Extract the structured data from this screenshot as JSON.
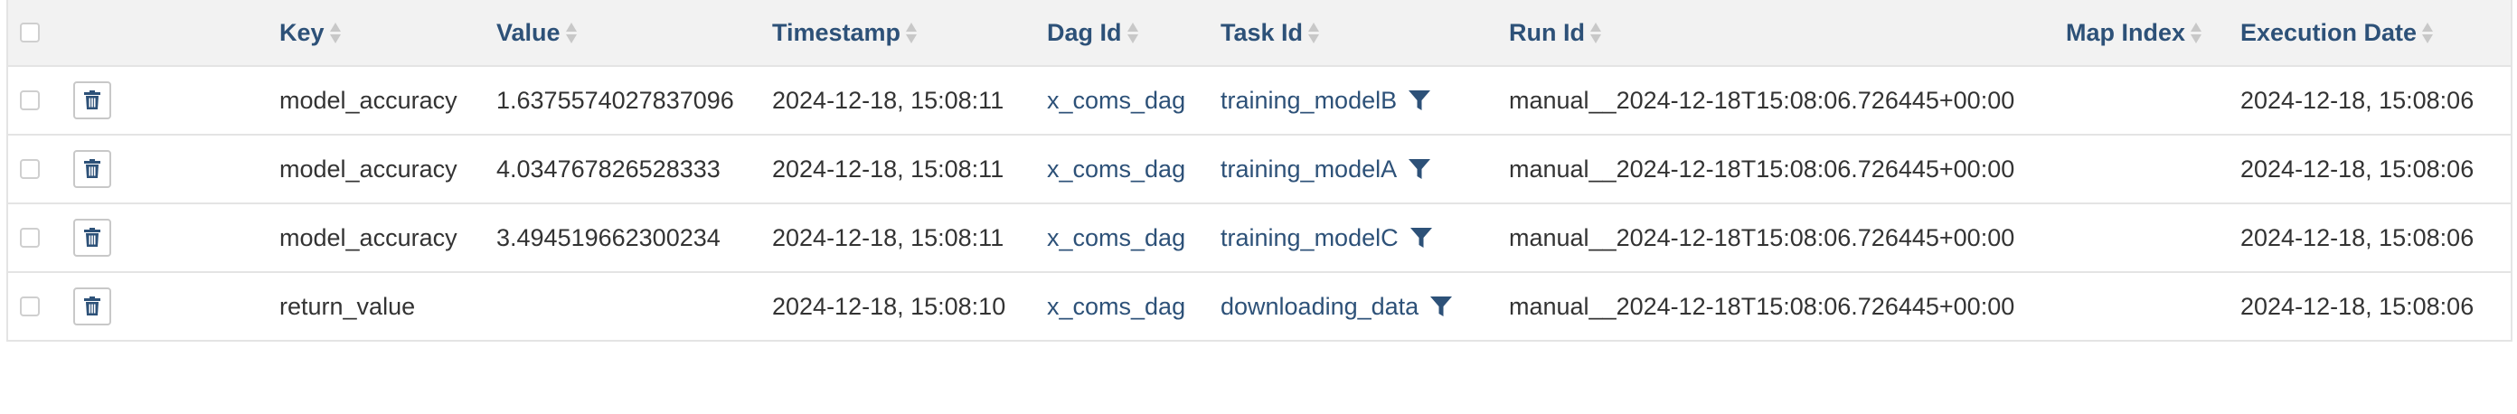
{
  "columns": {
    "key": "Key",
    "value": "Value",
    "timestamp": "Timestamp",
    "dag_id": "Dag Id",
    "task_id": "Task Id",
    "run_id": "Run Id",
    "map_index": "Map Index",
    "execution_date": "Execution Date"
  },
  "rows": [
    {
      "key": "model_accuracy",
      "value": "1.6375574027837096",
      "timestamp": "2024-12-18, 15:08:11",
      "dag_id": "x_coms_dag",
      "task_id": "training_modelB",
      "run_id": "manual__2024-12-18T15:08:06.726445+00:00",
      "map_index": "",
      "execution_date": "2024-12-18, 15:08:06"
    },
    {
      "key": "model_accuracy",
      "value": "4.034767826528333",
      "timestamp": "2024-12-18, 15:08:11",
      "dag_id": "x_coms_dag",
      "task_id": "training_modelA",
      "run_id": "manual__2024-12-18T15:08:06.726445+00:00",
      "map_index": "",
      "execution_date": "2024-12-18, 15:08:06"
    },
    {
      "key": "model_accuracy",
      "value": "3.494519662300234",
      "timestamp": "2024-12-18, 15:08:11",
      "dag_id": "x_coms_dag",
      "task_id": "training_modelC",
      "run_id": "manual__2024-12-18T15:08:06.726445+00:00",
      "map_index": "",
      "execution_date": "2024-12-18, 15:08:06"
    },
    {
      "key": "return_value",
      "value": "",
      "timestamp": "2024-12-18, 15:08:10",
      "dag_id": "x_coms_dag",
      "task_id": "downloading_data",
      "run_id": "manual__2024-12-18T15:08:06.726445+00:00",
      "map_index": "",
      "execution_date": "2024-12-18, 15:08:06"
    }
  ],
  "colors": {
    "header_text": "#2d5178",
    "link": "#2d5178",
    "body_text": "#333333",
    "header_bg": "#f2f2f2",
    "border": "#e4e4e4"
  },
  "icons": {
    "delete": "trash-icon",
    "filter": "filter-icon",
    "sort": "sort-icon"
  }
}
